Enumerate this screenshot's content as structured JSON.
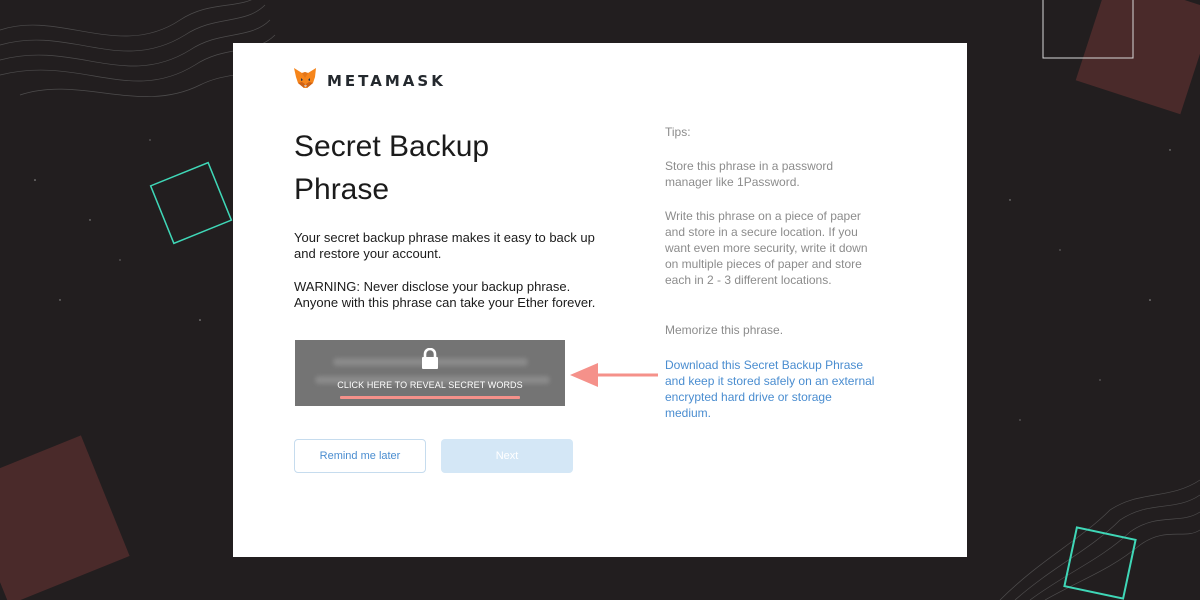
{
  "brand": {
    "name": "METAMASK"
  },
  "page": {
    "title": "Secret Backup Phrase",
    "description": "Your secret backup phrase makes it easy to back up and restore your account.",
    "warning": "WARNING: Never disclose your backup phrase. Anyone with this phrase can take your Ether forever."
  },
  "reveal": {
    "label": "CLICK HERE TO REVEAL SECRET WORDS"
  },
  "buttons": {
    "remind": "Remind me later",
    "next": "Next"
  },
  "tips": {
    "heading": "Tips:",
    "tip1": "Store this phrase in a password manager like 1Password.",
    "tip2": "Write this phrase on a piece of paper and store in a secure location. If you want even more security, write it down on multiple pieces of paper and store each in 2 - 3 different locations.",
    "tip3": "Memorize this phrase.",
    "download": "Download this Secret Backup Phrase and keep it stored safely on an external encrypted hard drive or storage medium."
  },
  "colors": {
    "background": "#221e1f",
    "accent_link": "#4a8dd0",
    "highlight": "#f5918a",
    "teal_square": "#3fd7b7",
    "maroon_square": "#4a2a2a"
  }
}
